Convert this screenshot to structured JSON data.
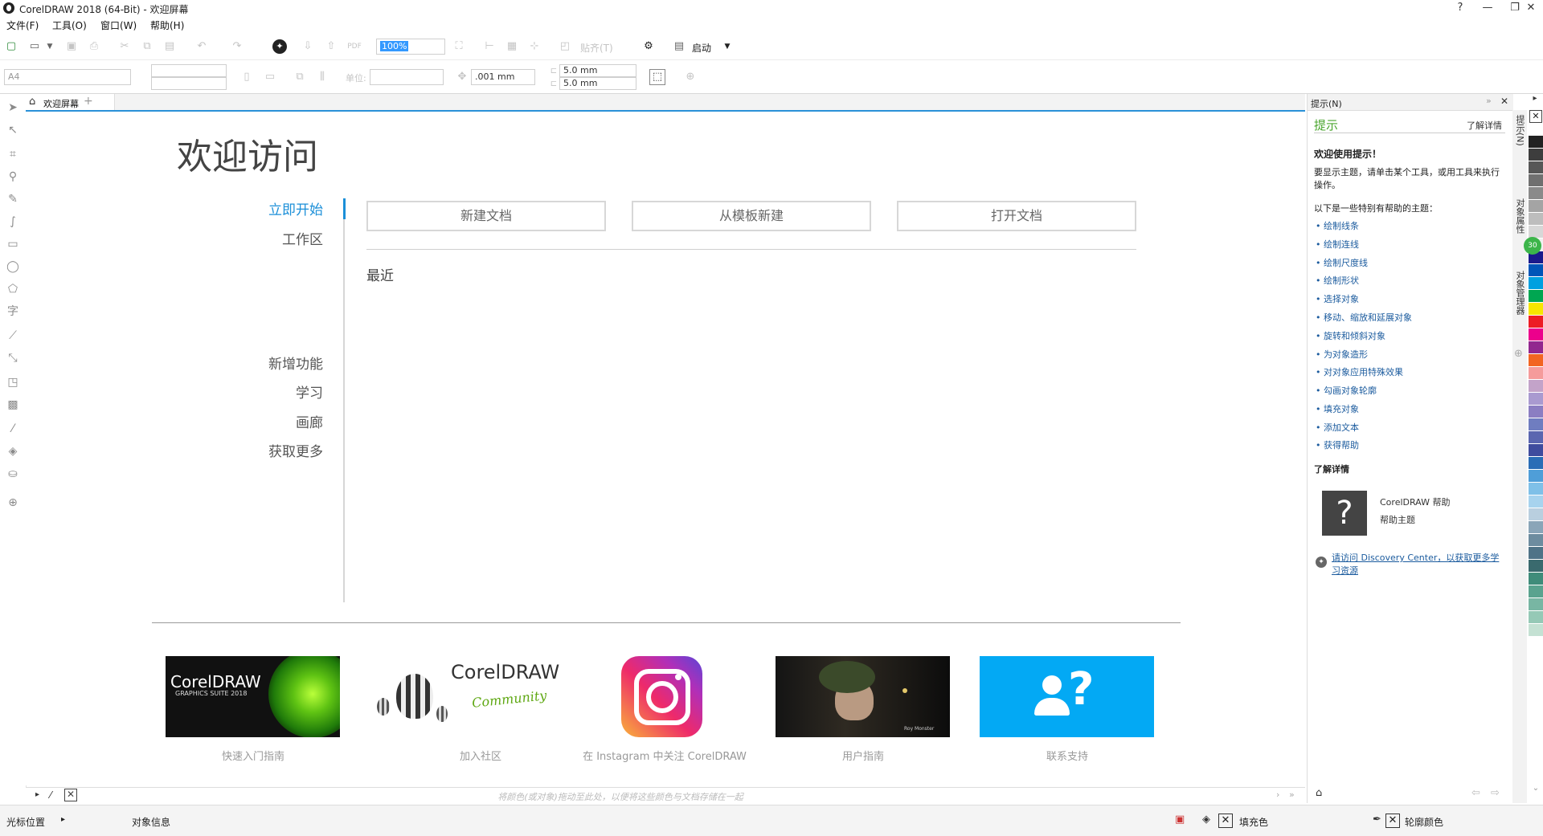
{
  "window": {
    "title": "CorelDRAW 2018 (64-Bit) - 欢迎屏幕",
    "controls": [
      "?",
      "—",
      "❐",
      "✕"
    ]
  },
  "menu": [
    "文件(F)",
    "工具(O)",
    "窗口(W)",
    "帮助(H)"
  ],
  "toolbar": {
    "zoom_value": "100%",
    "snap_label": "贴齐(T)",
    "launch_label": "启动",
    "page_size": "A4",
    "units_label": "单位:",
    "nudge": ".001 mm",
    "dup_x": "5.0 mm",
    "dup_y": "5.0 mm"
  },
  "tab": {
    "label": "欢迎屏幕"
  },
  "welcome": {
    "heading": "欢迎访问",
    "nav_top": [
      "立即开始",
      "工作区"
    ],
    "nav_bottom": [
      "新增功能",
      "学习",
      "画廊",
      "获取更多"
    ],
    "buttons": [
      "新建文档",
      "从模板新建",
      "打开文档"
    ],
    "recent_label": "最近",
    "tiles": [
      {
        "caption": "快速入门指南",
        "brand": "CorelDRAW",
        "sub": "GRAPHICS SUITE 2018"
      },
      {
        "caption": "加入社区",
        "brand": "CorelDRAW",
        "sub": "Community"
      },
      {
        "caption": "在 Instagram 中关注 CorelDRAW"
      },
      {
        "caption": "用户指南",
        "sub": "Roy Monster"
      },
      {
        "caption": "联系支持"
      }
    ]
  },
  "docbar": {
    "hint": "将颜色(或对象)拖动至此处，以便将这些颜色与文档存储在一起"
  },
  "docker": {
    "header": "提示(N)",
    "title": "提示",
    "more_link": "了解详情",
    "welcome_title": "欢迎使用提示！",
    "intro": "要显示主题，请单击某个工具，或用工具来执行操作。",
    "list_intro": "以下是一些特别有帮助的主题：",
    "topics": [
      "绘制线条",
      "绘制连线",
      "绘制尺度线",
      "绘制形状",
      "选择对象",
      "移动、缩放和延展对象",
      "旋转和倾斜对象",
      "为对象造形",
      "对对象应用特殊效果",
      "勾画对象轮廓",
      "填充对象",
      "添加文本",
      "获得帮助"
    ],
    "learn_more": "了解详情",
    "help_title": "CorelDRAW 帮助",
    "help_sub": "帮助主题",
    "discovery": "请访问 Discovery Center，以获取更多学习资源"
  },
  "vtabs": [
    "提示(N)",
    "对象属性",
    "对象管理器"
  ],
  "palette_colors": [
    "#ffffff",
    "#222222",
    "#3d3d3d",
    "#575757",
    "#707070",
    "#8a8a8a",
    "#a4a4a4",
    "#bdbdbd",
    "#d7d7d7",
    "#f0f0f0",
    "#1a1a8c",
    "#0055b8",
    "#00a0e0",
    "#00a651",
    "#f7e600",
    "#ed1c24",
    "#ec008c",
    "#92278f",
    "#f26522",
    "#f59b9b",
    "#c3a3c9",
    "#a99ad0",
    "#8b7ec2",
    "#6f7dc0",
    "#5a66b0",
    "#3f4c9e",
    "#2a6db6",
    "#4f9ed8",
    "#7fc0e8",
    "#a7d3ee",
    "#b9cfdf",
    "#8aa5b8",
    "#6d8c9f",
    "#4f7387",
    "#3a6a6e",
    "#3f8c7a",
    "#5aa38f",
    "#78b6a3",
    "#95c9b6",
    "#c4e1d3"
  ],
  "status": {
    "cursor": "光标位置",
    "object_info": "对象信息",
    "fill_label": "填充色",
    "outline_label": "轮廓颜色"
  }
}
